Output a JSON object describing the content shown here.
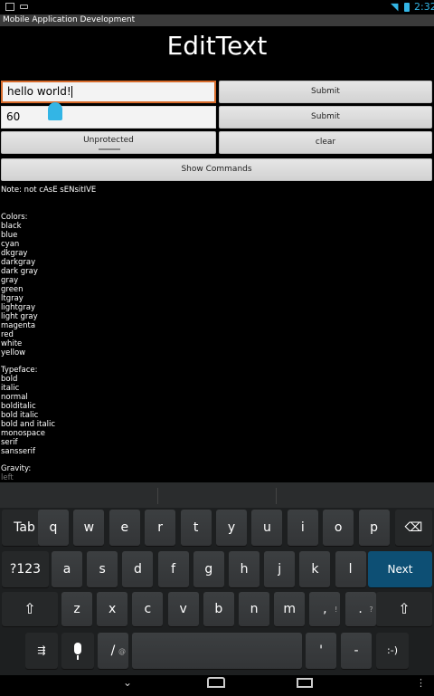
{
  "status": {
    "time": "2:32"
  },
  "window_title": "Mobile Application Development",
  "heading": "EditText",
  "inputs": {
    "first_value": "hello world!",
    "second_value": "60"
  },
  "buttons": {
    "submit1": "Submit",
    "submit2": "Submit",
    "unprotected": "Unprotected",
    "clear": "clear",
    "show_commands": "Show Commands"
  },
  "note": "Note: not cAsE sENsitIVE",
  "colors_title": "Colors:",
  "colors": [
    "black",
    "blue",
    "cyan",
    "dkgray",
    "darkgray",
    "dark gray",
    "gray",
    "green",
    "ltgray",
    "lightgray",
    "light gray",
    "magenta",
    "red",
    "white",
    "yellow"
  ],
  "typeface_title": "Typeface:",
  "typefaces": [
    "bold",
    "italic",
    "normal",
    "bolditalic",
    "bold italic",
    "bold and italic",
    "monospace",
    "serif",
    "sansserif"
  ],
  "gravity_title": "Gravity:",
  "gravity_partial": "left",
  "keyboard": {
    "row1": [
      "Tab",
      "q",
      "w",
      "e",
      "r",
      "t",
      "y",
      "u",
      "i",
      "o",
      "p"
    ],
    "row2": [
      "?123",
      "a",
      "s",
      "d",
      "f",
      "g",
      "h",
      "j",
      "k",
      "l",
      "Next"
    ],
    "row3": [
      "z",
      "x",
      "c",
      "v",
      "b",
      "n",
      "m",
      "!",
      "?"
    ],
    "row4_slash": "/",
    "row4_apostrophe": "'",
    "row4_dash": "-",
    "row4_smiley": ":-)",
    "hints": {
      "slash": "@",
      "bang": "!",
      "question": "?"
    }
  }
}
